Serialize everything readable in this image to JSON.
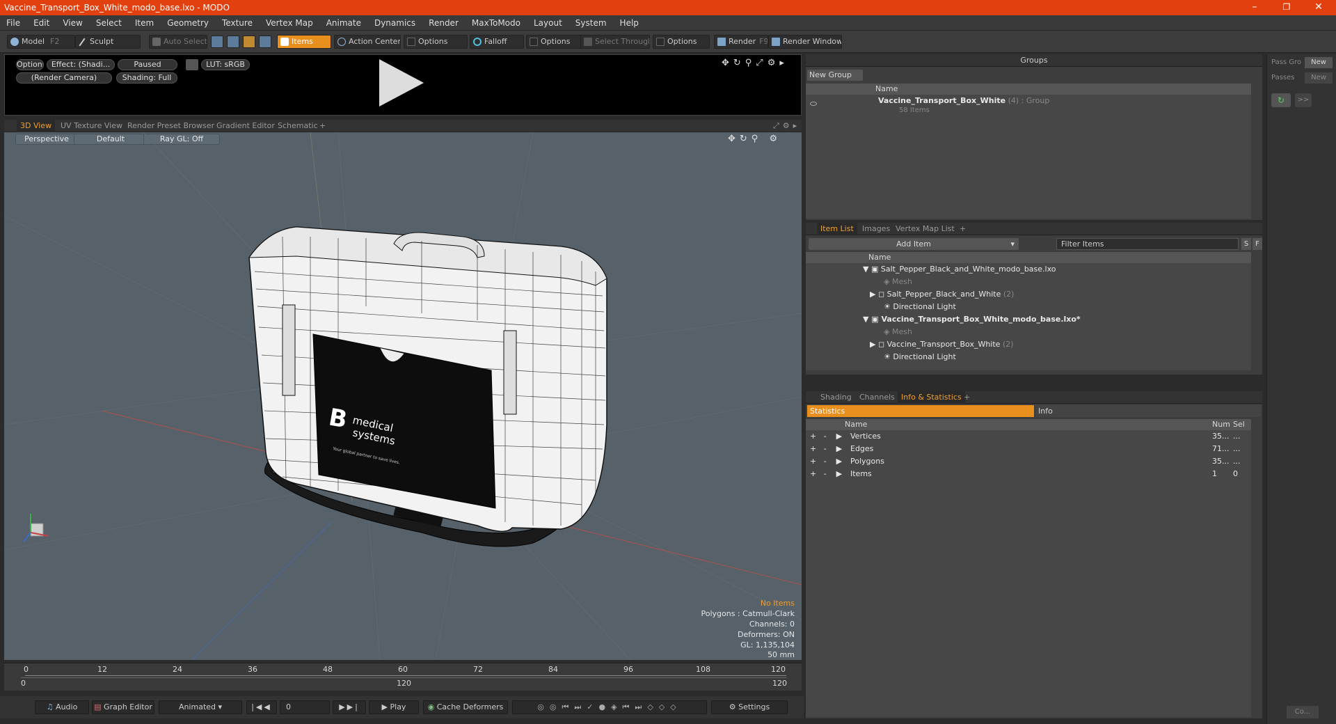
{
  "window": {
    "title": "Vaccine_Transport_Box_White_modo_base.lxo - MODO",
    "minimize": "–",
    "maximize": "❐",
    "close": "✕"
  },
  "menu": [
    "File",
    "Edit",
    "View",
    "Select",
    "Item",
    "Geometry",
    "Texture",
    "Vertex Map",
    "Animate",
    "Dynamics",
    "Render",
    "MaxToModo",
    "Layout",
    "System",
    "Help"
  ],
  "toolbar": {
    "model": "Model",
    "model_key": "F2",
    "sculpt": "Sculpt",
    "auto_select": "Auto Select",
    "items": "Items",
    "action_center": "Action Center",
    "options1": "Options",
    "falloff": "Falloff",
    "options2": "Options",
    "select_through": "Select Through",
    "options3": "Options",
    "render": "Render",
    "render_key": "F9",
    "render_window": "Render Window"
  },
  "render_preview": {
    "options": "Options",
    "effect": "Effect: (Shadi...",
    "paused": "Paused",
    "lut": "LUT: sRGB",
    "camera": "(Render Camera)",
    "shading": "Shading: Full"
  },
  "view_tabs": [
    "3D View",
    "UV Texture View",
    "Render Preset Browser",
    "Gradient Editor",
    "Schematic",
    "+"
  ],
  "viewport": {
    "perspective": "Perspective",
    "default": "Default",
    "raygl": "Ray GL: Off",
    "info": {
      "no_items": "No Items",
      "polygons": "Polygons : Catmull-Clark",
      "channels": "Channels: 0",
      "deformers": "Deformers: ON",
      "gl": "GL: 1,135,104",
      "focal": "50 mm"
    },
    "box_label": {
      "brand": "B",
      "name1": "medical",
      "name2": "systems",
      "tagline": "Your global partner to save lives."
    }
  },
  "timeline": {
    "ticks": [
      "0",
      "12",
      "24",
      "36",
      "48",
      "60",
      "72",
      "84",
      "96",
      "108",
      "120"
    ],
    "range_start": "0",
    "range_mid": "120",
    "range_end": "120"
  },
  "bottom": {
    "audio": "Audio",
    "graph_editor": "Graph Editor",
    "animated": "Animated",
    "frame": "0",
    "play": "Play",
    "cache": "Cache Deformers",
    "settings": "Settings"
  },
  "groups": {
    "title": "Groups",
    "new_group": "New Group",
    "col_name": "Name",
    "item_name": "Vaccine_Transport_Box_White",
    "item_count": "(4)",
    "item_type": ": Group",
    "item_sub": "58 Items"
  },
  "side": {
    "pass_group": "Pass Gro",
    "new1": "New",
    "passes": "Passes",
    "new2": "New",
    "chev": ">>",
    "co": "Co..."
  },
  "itemlist": {
    "tabs": [
      "Item List",
      "Images",
      "Vertex Map List",
      "+"
    ],
    "add_item": "Add Item",
    "filter": "Filter Items",
    "s": "S",
    "f": "F",
    "col_name": "Name",
    "rows": [
      {
        "label": "Salt_Pepper_Black_and_White_modo_base.lxo",
        "count": ""
      },
      {
        "label": "Mesh",
        "count": ""
      },
      {
        "label": "Salt_Pepper_Black_and_White",
        "count": "(2)"
      },
      {
        "label": "Directional Light",
        "count": ""
      },
      {
        "label": "Vaccine_Transport_Box_White_modo_base.lxo*",
        "count": ""
      },
      {
        "label": "Mesh",
        "count": ""
      },
      {
        "label": "Vaccine_Transport_Box_White",
        "count": "(2)"
      },
      {
        "label": "Directional Light",
        "count": ""
      }
    ]
  },
  "stats": {
    "tabs": [
      "Shading",
      "Channels",
      "Info & Statistics",
      "+"
    ],
    "statistics": "Statistics",
    "info": "Info",
    "cols": {
      "name": "Name",
      "num": "Num",
      "sel": "Sel"
    },
    "rows": [
      {
        "name": "Vertices",
        "num": "35...",
        "sel": "..."
      },
      {
        "name": "Edges",
        "num": "71...",
        "sel": "..."
      },
      {
        "name": "Polygons",
        "num": "35...",
        "sel": "..."
      },
      {
        "name": "Items",
        "num": "1",
        "sel": "0"
      }
    ]
  }
}
